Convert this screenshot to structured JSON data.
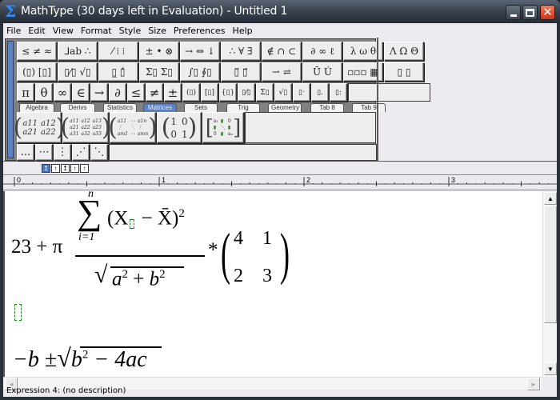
{
  "window": {
    "title": "MathType (30 days left in Evaluation) - Untitled 1",
    "app_icon": "Σ",
    "controls": {
      "minimize": "minimize",
      "maximize": "maximize",
      "close": "✕"
    }
  },
  "menu": [
    "File",
    "Edit",
    "View",
    "Format",
    "Style",
    "Size",
    "Preferences",
    "Help"
  ],
  "palette": {
    "row1": [
      "≤ ≠ ≈",
      "⅃ab ∴",
      "⁄ ⁞ ⁞",
      "± • ⊗",
      "→ ⇔ ↓",
      "∴ ∀ ∃",
      "∉ ∩ ⊂",
      "∂ ∞ ℓ",
      "λ ω θ",
      "Λ Ω Θ"
    ],
    "row2": [
      "(▯) [▯]",
      "▯⁄▯ √▯",
      "▯̲ ▯̂",
      "Σ▯ Σ▯",
      "∫▯ ∮▯",
      "▯̅ ▯⃗",
      "⇀ ⇌",
      "Ū̇ U̇",
      "▫▫▫ ▦",
      "▯ ▯"
    ],
    "row3": [
      "π",
      "θ",
      "∞",
      "∈",
      "→",
      "∂",
      "≤",
      "≠",
      "±",
      "(▯)",
      "[▯]",
      "{▯}",
      "▯⁄▯",
      "Σ▯",
      "√▯",
      "▯ˑ",
      "▯.",
      "▯:"
    ],
    "tabs": [
      {
        "label": "Algebra",
        "active": false
      },
      {
        "label": "Derivs",
        "active": false
      },
      {
        "label": "Statistics",
        "active": false
      },
      {
        "label": "Matrices",
        "active": true
      },
      {
        "label": "Sets",
        "active": false
      },
      {
        "label": "Trig",
        "active": false
      },
      {
        "label": "Geometry",
        "active": false
      },
      {
        "label": "Tab 8",
        "active": false
      },
      {
        "label": "Tab 9",
        "active": false
      }
    ],
    "matrices": {
      "m2x2": [
        "a11",
        "a12",
        "a21",
        "a22"
      ],
      "m3x3": [
        "a11",
        "a12",
        "a13",
        "a21",
        "a22",
        "a23",
        "a31",
        "a32",
        "a33"
      ],
      "mnxm": [
        "a11",
        "⋯",
        "a1n",
        "⋮",
        "⋱",
        "⋮",
        "am1",
        "⋯",
        "amn"
      ],
      "identity": [
        "1",
        "0",
        "0",
        "1"
      ],
      "diag": [
        "a₁",
        "▮",
        "0",
        "▮",
        "⋱",
        "▮",
        "0",
        "▮",
        "aₙ"
      ]
    },
    "dots": [
      "...",
      "⋯",
      "⋮",
      "⋰",
      "⋱"
    ]
  },
  "mini_buttons": [
    "↥",
    "↑",
    "↥",
    "↑",
    "↑"
  ],
  "ruler": {
    "labels": [
      "0",
      "1",
      "2",
      "3"
    ]
  },
  "document": {
    "expr1": {
      "prefix": "23 + π",
      "sum_upper": "n",
      "sum_lower": "i=1",
      "numerator": "(X",
      "numerator_rest": " − X̄)",
      "numerator_exp": "2",
      "denominator": "a² + b²",
      "denom_a": "a",
      "denom_b": "b",
      "exp": "2",
      "times": "*",
      "matrix": [
        "4",
        "1",
        "2",
        "3"
      ]
    },
    "expr3": {
      "minus_b": "−b",
      "pm": "±",
      "b": "b",
      "exp": "2",
      "rest": " − 4ac"
    }
  },
  "status": {
    "text": "Expression 4: (no description)"
  },
  "scroll": {
    "up": "▲",
    "down": "▼",
    "left": "◄",
    "right": "►"
  }
}
